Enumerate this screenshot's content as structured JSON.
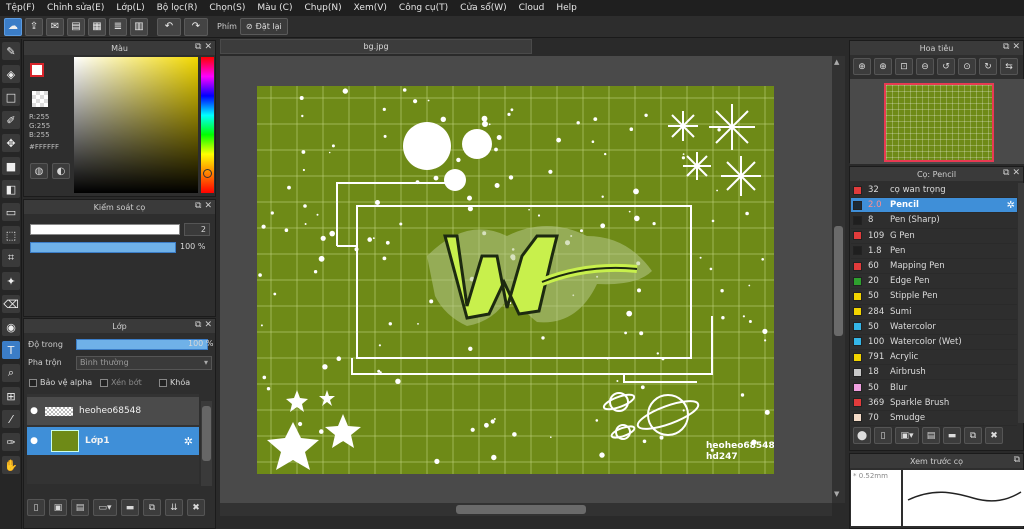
{
  "menu": [
    "Tệp(F)",
    "Chỉnh sửa(E)",
    "Lớp(L)",
    "Bộ lọc(R)",
    "Chọn(S)",
    "Màu (C)",
    "Chụp(N)",
    "Xem(V)",
    "Công cụ(T)",
    "Cửa sổ(W)",
    "Cloud",
    "Help"
  ],
  "toolbar": {
    "phim_label": "Phím",
    "reset_label": "Đặt lại"
  },
  "color_panel": {
    "title": "Màu",
    "r": "R:255",
    "g": "G:255",
    "b": "B:255",
    "hex": "#FFFFFF"
  },
  "brush_control": {
    "title": "Kiểm soát cọ",
    "size": "2",
    "opacity": "100 %"
  },
  "layer_panel": {
    "title": "Lớp",
    "opacity_label": "Độ trong",
    "opacity_value": "100 %",
    "blend_label": "Pha trộn",
    "blend_value": "Bình thường",
    "protect_alpha": "Bảo vệ alpha",
    "clip": "Xén bớt",
    "lock": "Khóa",
    "layers": [
      {
        "name": "heoheo68548"
      },
      {
        "name": "Lớp1"
      }
    ]
  },
  "document": {
    "tab_title": "bg.jpg",
    "canvas_text_1": "heoheo68548",
    "canvas_text_2": "hd247",
    "canvas_bg": "#6e8a17"
  },
  "navigator": {
    "title": "Hoa tiêu"
  },
  "brush_panel": {
    "title": "Cọ: Pencil",
    "brushes": [
      {
        "size": "32",
        "name": "cọ wan trọng",
        "color": "#e23b3b"
      },
      {
        "size": "2.0",
        "name": "Pencil",
        "color": "#1c2a36",
        "selected": true
      },
      {
        "size": "8",
        "name": "Pen (Sharp)",
        "color": "#1f1f1f"
      },
      {
        "size": "109",
        "name": "G Pen",
        "color": "#e23b3b"
      },
      {
        "size": "1.8",
        "name": "Pen",
        "color": "#1f1f1f"
      },
      {
        "size": "60",
        "name": "Mapping Pen",
        "color": "#e23b3b"
      },
      {
        "size": "20",
        "name": "Edge Pen",
        "color": "#2ea12e"
      },
      {
        "size": "50",
        "name": "Stipple Pen",
        "color": "#f2d400"
      },
      {
        "size": "284",
        "name": "Sumi",
        "color": "#f2d400"
      },
      {
        "size": "50",
        "name": "Watercolor",
        "color": "#34b6e8"
      },
      {
        "size": "100",
        "name": "Watercolor (Wet)",
        "color": "#34b6e8"
      },
      {
        "size": "791",
        "name": "Acrylic",
        "color": "#f2d400"
      },
      {
        "size": "18",
        "name": "Airbrush",
        "color": "#c8c8c8"
      },
      {
        "size": "50",
        "name": "Blur",
        "color": "#f0a0e0"
      },
      {
        "size": "369",
        "name": "Sparkle Brush",
        "color": "#e23b3b"
      },
      {
        "size": "70",
        "name": "Smudge",
        "color": "#f5dcc8"
      }
    ]
  },
  "preview": {
    "title": "Xem trước cọ",
    "size_label": "* 0.52mm"
  }
}
